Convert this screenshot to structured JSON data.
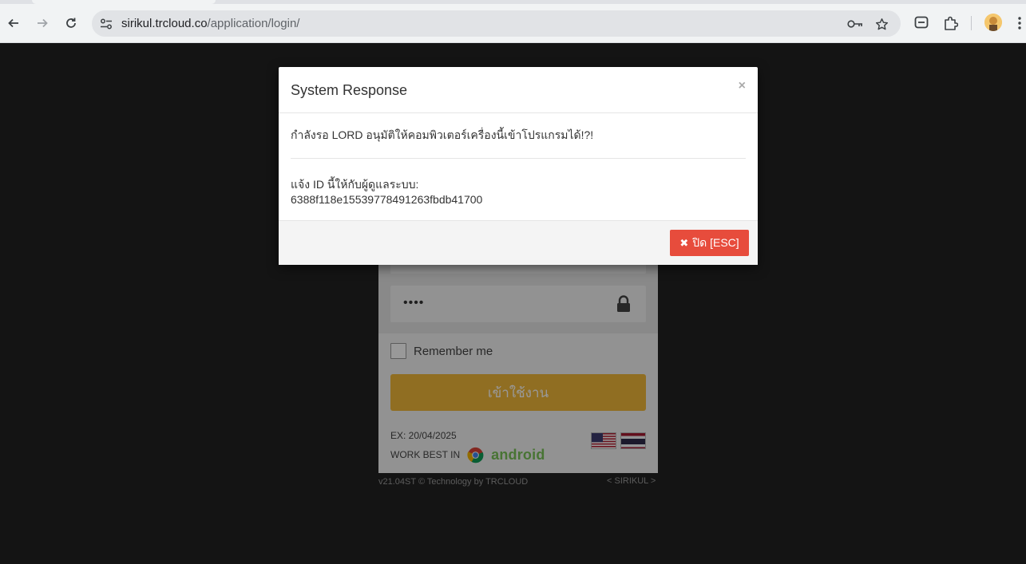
{
  "browser": {
    "url_host": "sirikul.trcloud.co",
    "url_path": "/application/login/",
    "icons": {
      "back": "arrow-left-icon",
      "forward": "arrow-right-icon",
      "reload": "reload-icon",
      "site_info": "tune-icon",
      "password": "key-icon",
      "bookmark": "star-icon",
      "chat": "chat-icon",
      "extensions": "puzzle-icon",
      "profile": "avatar-icon",
      "menu": "more-vert-icon"
    }
  },
  "login": {
    "password_value": "••••",
    "remember_label": "Remember me",
    "login_button": "เข้าใช้งาน",
    "expiry": "EX: 20/04/2025",
    "work_best_label": "WORK BEST IN",
    "android_word": "android",
    "footer_version": "v21.04ST © Technology by TRCLOUD",
    "footer_brand": "< SIRIKUL >",
    "colors": {
      "button": "#f0b73a",
      "android": "#78c257"
    }
  },
  "modal": {
    "title": "System Response",
    "close_glyph": "×",
    "waiting_message": "กำลังรอ LORD อนุมัติให้คอมพิวเตอร์เครื่องนี้เข้าโปรแกรมได้!?!",
    "id_label": "แจ้ง ID นี้ให้กับผู้ดูแลระบบ:",
    "id_value": "6388f118e15539778491263fbdb41700",
    "close_button_mark": "✖",
    "close_button_label": "ปิด [ESC]",
    "colors": {
      "close_button": "#e74c3c"
    }
  }
}
